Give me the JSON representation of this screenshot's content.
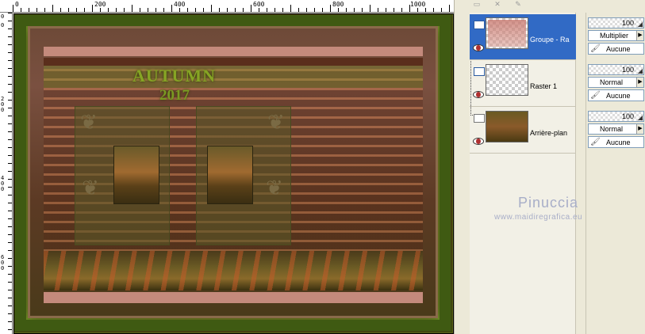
{
  "rulers": {
    "top_labels": [
      "0",
      "200",
      "400",
      "600",
      "800",
      "1000"
    ],
    "left_labels": [
      "0",
      "0",
      "2\n0\n0",
      "4\n0\n0",
      "6\n0\n0"
    ]
  },
  "artwork": {
    "title": "AUTUMN",
    "year": "2017"
  },
  "layers": [
    {
      "name": "Groupe - Ra",
      "type": "group",
      "selected": true,
      "opacity": "100",
      "blend": "Multiplier",
      "link": "Aucune"
    },
    {
      "name": "Raster 1",
      "type": "raster",
      "selected": false,
      "opacity": "100",
      "blend": "Normal",
      "link": "Aucune"
    },
    {
      "name": "Arrière-plan",
      "type": "background",
      "selected": false,
      "opacity": "100",
      "blend": "Normal",
      "link": "Aucune"
    }
  ],
  "watermark": {
    "name": "Pinuccia",
    "url": "www.maidiregrafica.eu"
  },
  "colors": {
    "selected_row": "#316ac5",
    "panel_bg": "#ece9d8",
    "art_title": "#86a424"
  }
}
